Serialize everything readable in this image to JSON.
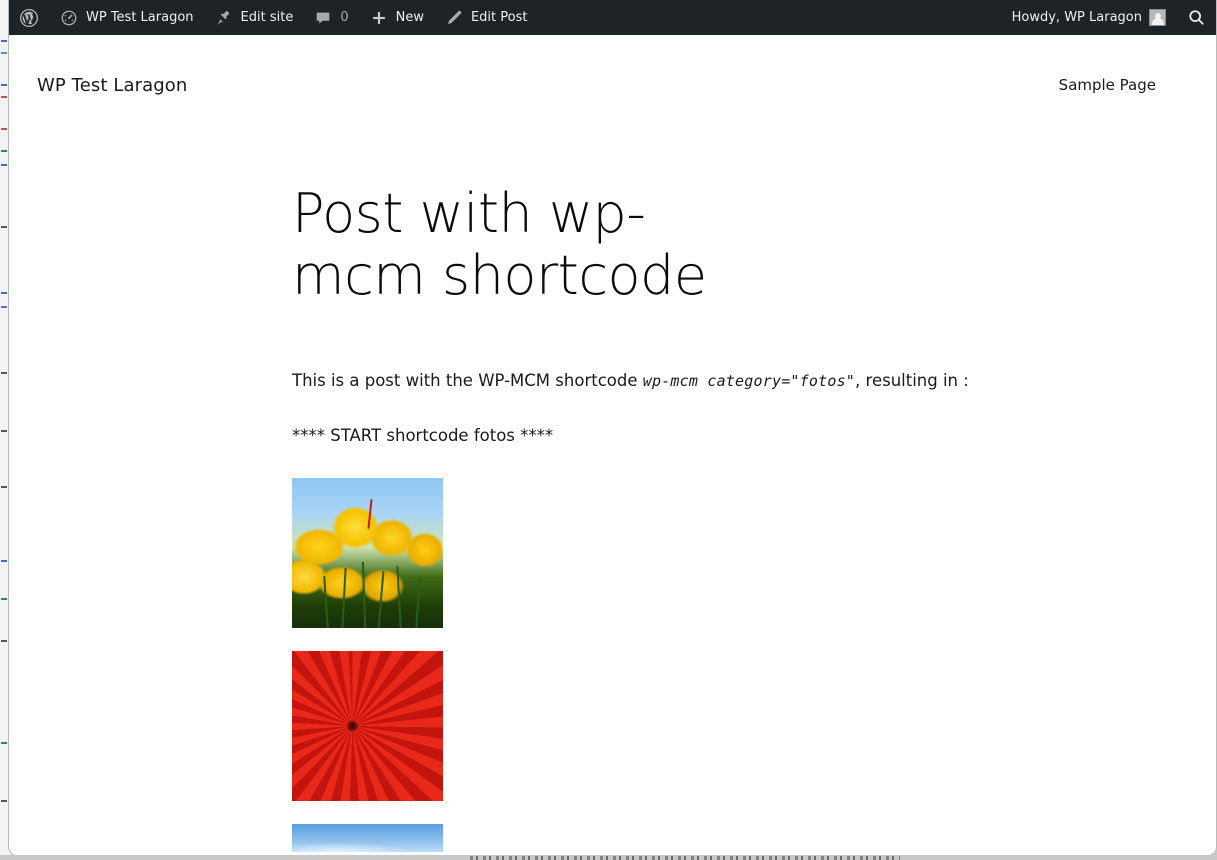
{
  "admin_bar": {
    "background_color": "#1d2327",
    "text_color": "#f0f0f1",
    "wp_logo_label": "WordPress",
    "items": [
      {
        "icon": "wordpress-logo-icon",
        "label": ""
      },
      {
        "icon": "dashboard-speedometer-icon",
        "label": "WP Test Laragon"
      },
      {
        "icon": "pushpin-icon",
        "label": "Edit site"
      },
      {
        "icon": "comment-bubble-icon",
        "label": "0"
      },
      {
        "icon": "plus-icon",
        "label": "New"
      },
      {
        "icon": "pencil-icon",
        "label": "Edit Post"
      }
    ],
    "account": {
      "greeting": "Howdy, WP Laragon",
      "avatar_icon": "user-avatar-icon"
    },
    "search_icon": "search-icon",
    "comment_count": "0"
  },
  "site_header": {
    "title": "WP Test Laragon",
    "nav": [
      {
        "label": "Sample Page"
      }
    ]
  },
  "post": {
    "title": "Post with wp-mcm shortcode",
    "paragraphs": [
      {
        "before_code": "This is a post with the WP-MCM shortcode ",
        "code": "wp-mcm  category=\"fotos\"",
        "after_code": ", resulting in :"
      }
    ],
    "shortcode_start_marker": "**** START shortcode fotos ****",
    "gallery": {
      "category": "fotos",
      "items": [
        {
          "name": "yellow-tulips",
          "alt": "Yellow tulips against a blue sky"
        },
        {
          "name": "red-chrysanthemum",
          "alt": "Red-orange chrysanthemum flower"
        },
        {
          "name": "blue-sky",
          "alt": "Blue sky photo, partially visible"
        }
      ]
    }
  },
  "colors": {
    "admin_bar_bg": "#1d2327",
    "admin_bar_icon": "#a7aaad",
    "page_bg": "#ffffff",
    "body_text": "#1a1a1a"
  }
}
